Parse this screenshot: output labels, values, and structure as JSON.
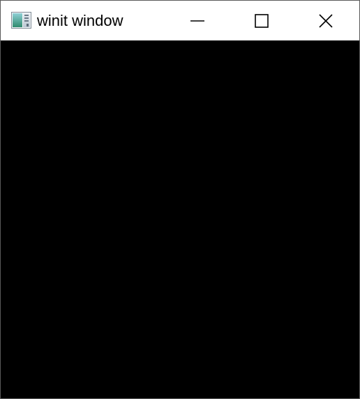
{
  "window": {
    "title": "winit window",
    "app_icon": "app-window-icon",
    "client_background": "#000000",
    "titlebar_background": "#ffffff"
  },
  "caption_buttons": [
    {
      "name": "minimize",
      "icon": "minimize-icon"
    },
    {
      "name": "maximize",
      "icon": "maximize-icon"
    },
    {
      "name": "close",
      "icon": "close-icon"
    }
  ]
}
